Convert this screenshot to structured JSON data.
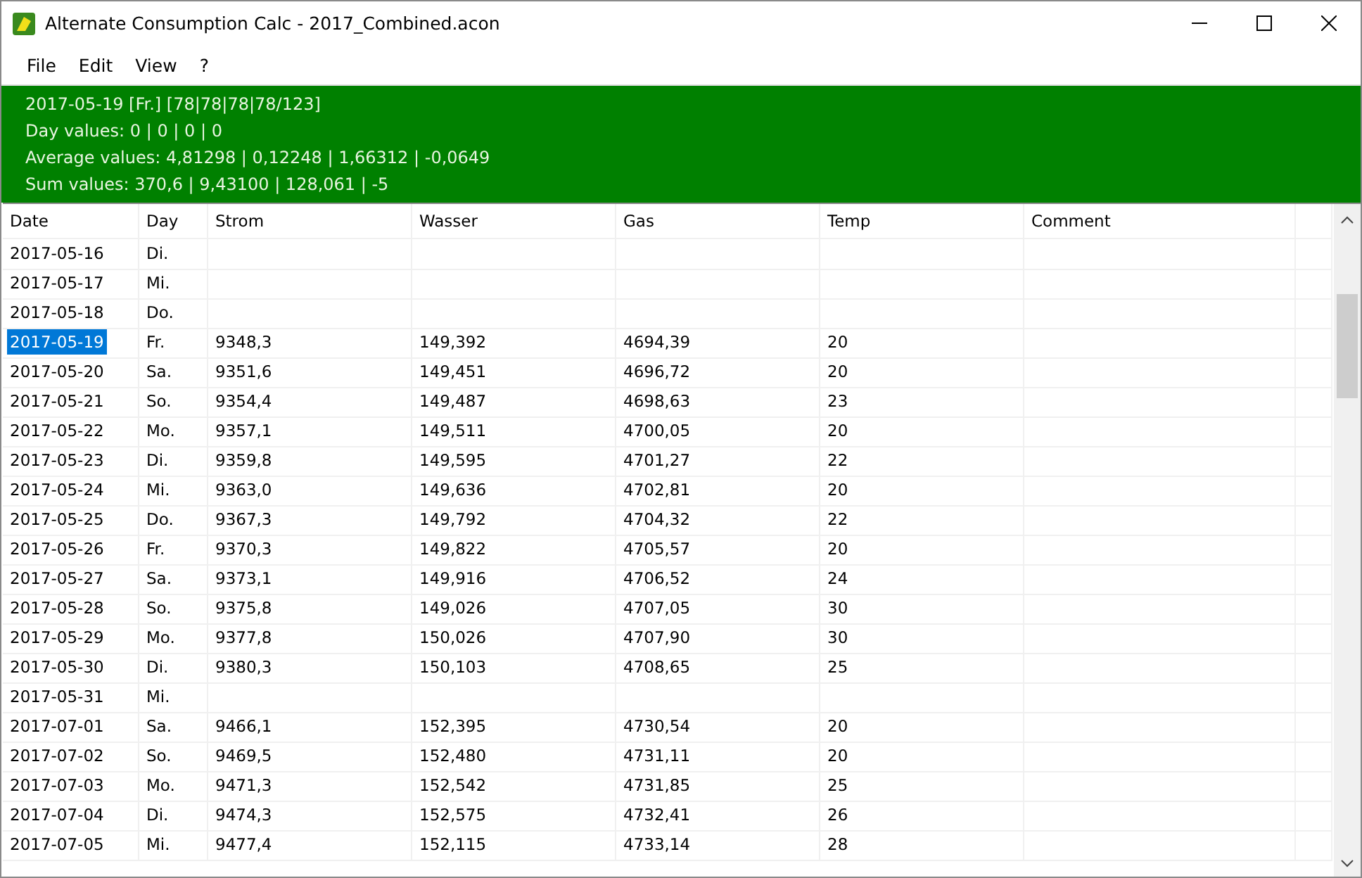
{
  "window": {
    "title": "Alternate Consumption Calc - 2017_Combined.acon"
  },
  "menu": [
    "File",
    "Edit",
    "View",
    "?"
  ],
  "summary": [
    "2017-05-19 [Fr.] [78|78|78|78/123]",
    "Day values: 0 | 0 | 0 | 0",
    "Average values: 4,81298 | 0,12248 | 1,66312 | -0,0649",
    "Sum values: 370,6 | 9,43100 | 128,061 | -5"
  ],
  "table": {
    "columns": [
      "Date",
      "Day",
      "Strom",
      "Wasser",
      "Gas",
      "Temp",
      "Comment"
    ],
    "rows": [
      {
        "cells": [
          "2017-05-16",
          "Di.",
          "",
          "",
          "",
          "",
          ""
        ],
        "selected": false
      },
      {
        "cells": [
          "2017-05-17",
          "Mi.",
          "",
          "",
          "",
          "",
          ""
        ],
        "selected": false
      },
      {
        "cells": [
          "2017-05-18",
          "Do.",
          "",
          "",
          "",
          "",
          ""
        ],
        "selected": false
      },
      {
        "cells": [
          "2017-05-19",
          "Fr.",
          "9348,3",
          "149,392",
          "4694,39",
          "20",
          ""
        ],
        "selected": true
      },
      {
        "cells": [
          "2017-05-20",
          "Sa.",
          "9351,6",
          "149,451",
          "4696,72",
          "20",
          ""
        ],
        "selected": false
      },
      {
        "cells": [
          "2017-05-21",
          "So.",
          "9354,4",
          "149,487",
          "4698,63",
          "23",
          ""
        ],
        "selected": false
      },
      {
        "cells": [
          "2017-05-22",
          "Mo.",
          "9357,1",
          "149,511",
          "4700,05",
          "20",
          ""
        ],
        "selected": false
      },
      {
        "cells": [
          "2017-05-23",
          "Di.",
          "9359,8",
          "149,595",
          "4701,27",
          "22",
          ""
        ],
        "selected": false
      },
      {
        "cells": [
          "2017-05-24",
          "Mi.",
          "9363,0",
          "149,636",
          "4702,81",
          "20",
          ""
        ],
        "selected": false
      },
      {
        "cells": [
          "2017-05-25",
          "Do.",
          "9367,3",
          "149,792",
          "4704,32",
          "22",
          ""
        ],
        "selected": false
      },
      {
        "cells": [
          "2017-05-26",
          "Fr.",
          "9370,3",
          "149,822",
          "4705,57",
          "20",
          ""
        ],
        "selected": false
      },
      {
        "cells": [
          "2017-05-27",
          "Sa.",
          "9373,1",
          "149,916",
          "4706,52",
          "24",
          ""
        ],
        "selected": false
      },
      {
        "cells": [
          "2017-05-28",
          "So.",
          "9375,8",
          "149,026",
          "4707,05",
          "30",
          ""
        ],
        "selected": false
      },
      {
        "cells": [
          "2017-05-29",
          "Mo.",
          "9377,8",
          "150,026",
          "4707,90",
          "30",
          ""
        ],
        "selected": false
      },
      {
        "cells": [
          "2017-05-30",
          "Di.",
          "9380,3",
          "150,103",
          "4708,65",
          "25",
          ""
        ],
        "selected": false
      },
      {
        "cells": [
          "2017-05-31",
          "Mi.",
          "",
          "",
          "",
          "",
          ""
        ],
        "selected": false
      },
      {
        "cells": [
          "2017-07-01",
          "Sa.",
          "9466,1",
          "152,395",
          "4730,54",
          "20",
          ""
        ],
        "selected": false
      },
      {
        "cells": [
          "2017-07-02",
          "So.",
          "9469,5",
          "152,480",
          "4731,11",
          "20",
          ""
        ],
        "selected": false
      },
      {
        "cells": [
          "2017-07-03",
          "Mo.",
          "9471,3",
          "152,542",
          "4731,85",
          "25",
          ""
        ],
        "selected": false
      },
      {
        "cells": [
          "2017-07-04",
          "Di.",
          "9474,3",
          "152,575",
          "4732,41",
          "26",
          ""
        ],
        "selected": false
      },
      {
        "cells": [
          "2017-07-05",
          "Mi.",
          "9477,4",
          "152,115",
          "4733,14",
          "28",
          ""
        ],
        "selected": false
      }
    ]
  }
}
